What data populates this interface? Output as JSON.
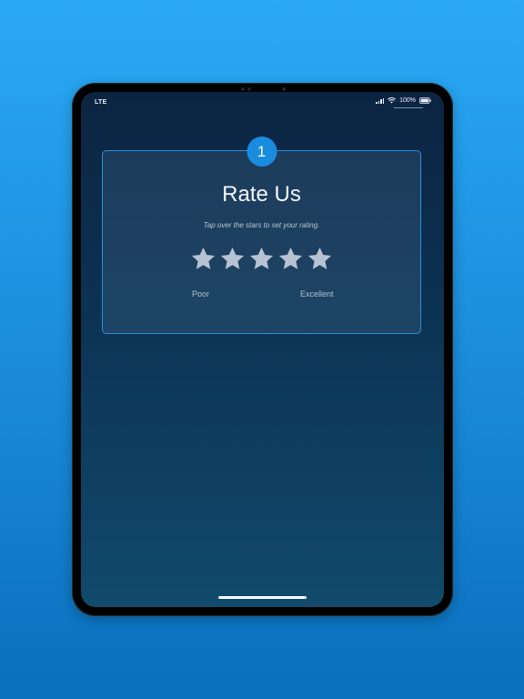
{
  "status_bar": {
    "carrier": "LTE",
    "battery_percent": "100%",
    "signal_icon": "signal-bars-icon",
    "wifi_icon": "wifi-icon",
    "battery_icon": "battery-icon"
  },
  "rate_card": {
    "step_number": "1",
    "title": "Rate Us",
    "subtitle": "Tap over the stars to set your rating.",
    "star_count": 5,
    "selected_rating": 0,
    "label_low": "Poor",
    "label_high": "Excellent"
  },
  "colors": {
    "background_top": "#2aa9f5",
    "background_bottom": "#0a6fbd",
    "screen_top": "#0c2442",
    "screen_bottom": "#114a6c",
    "accent": "#1a8ce0",
    "star_inactive": "#b7c3d3"
  }
}
